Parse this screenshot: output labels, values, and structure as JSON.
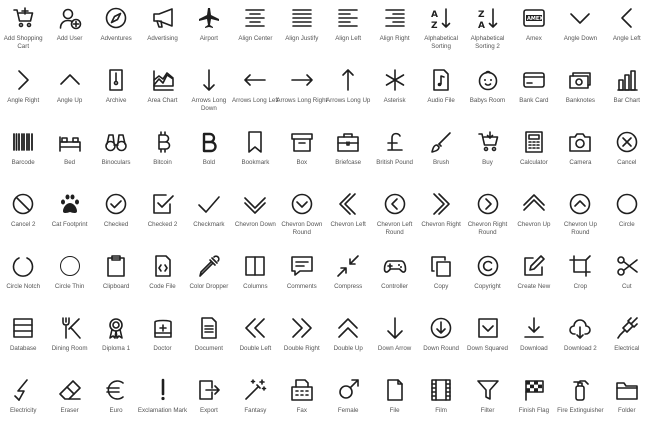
{
  "grid": {
    "columns": 14,
    "rows": 7,
    "items": [
      {
        "label": "Add Shopping Cart",
        "icon": "add-shopping-cart-icon"
      },
      {
        "label": "Add User",
        "icon": "add-user-icon"
      },
      {
        "label": "Adventures",
        "icon": "compass-icon"
      },
      {
        "label": "Advertising",
        "icon": "megaphone-icon"
      },
      {
        "label": "Airport",
        "icon": "airplane-icon"
      },
      {
        "label": "Align Center",
        "icon": "align-center-icon"
      },
      {
        "label": "Align Justify",
        "icon": "align-justify-icon"
      },
      {
        "label": "Align Left",
        "icon": "align-left-icon"
      },
      {
        "label": "Align Right",
        "icon": "align-right-icon"
      },
      {
        "label": "Alphabetical Sorting",
        "icon": "sort-az-icon"
      },
      {
        "label": "Alphabetical Sorting 2",
        "icon": "sort-za-icon"
      },
      {
        "label": "Amex",
        "icon": "amex-icon"
      },
      {
        "label": "Angle Down",
        "icon": "angle-down-icon"
      },
      {
        "label": "Angle Left",
        "icon": "angle-left-icon"
      },
      {
        "label": "Angle Right",
        "icon": "angle-right-icon"
      },
      {
        "label": "Angle Up",
        "icon": "angle-up-icon"
      },
      {
        "label": "Archive",
        "icon": "archive-icon"
      },
      {
        "label": "Area Chart",
        "icon": "area-chart-icon"
      },
      {
        "label": "Arrows Long Down",
        "icon": "arrow-long-down-icon"
      },
      {
        "label": "Arrows Long Left",
        "icon": "arrow-long-left-icon"
      },
      {
        "label": "Arrows Long Right",
        "icon": "arrow-long-right-icon"
      },
      {
        "label": "Arrows Long Up",
        "icon": "arrow-long-up-icon"
      },
      {
        "label": "Asterisk",
        "icon": "asterisk-icon"
      },
      {
        "label": "Audio File",
        "icon": "audio-file-icon"
      },
      {
        "label": "Babys Room",
        "icon": "baby-icon"
      },
      {
        "label": "Bank Card",
        "icon": "bank-card-icon"
      },
      {
        "label": "Banknotes",
        "icon": "banknotes-icon"
      },
      {
        "label": "Bar Chart",
        "icon": "bar-chart-icon"
      },
      {
        "label": "Barcode",
        "icon": "barcode-icon"
      },
      {
        "label": "Bed",
        "icon": "bed-icon"
      },
      {
        "label": "Binoculars",
        "icon": "binoculars-icon"
      },
      {
        "label": "Bitcoin",
        "icon": "bitcoin-icon"
      },
      {
        "label": "Bold",
        "icon": "bold-icon"
      },
      {
        "label": "Bookmark",
        "icon": "bookmark-icon"
      },
      {
        "label": "Box",
        "icon": "box-icon"
      },
      {
        "label": "Briefcase",
        "icon": "briefcase-icon"
      },
      {
        "label": "British Pound",
        "icon": "pound-icon"
      },
      {
        "label": "Brush",
        "icon": "brush-icon"
      },
      {
        "label": "Buy",
        "icon": "buy-cart-icon"
      },
      {
        "label": "Calculator",
        "icon": "calculator-icon"
      },
      {
        "label": "Camera",
        "icon": "camera-icon"
      },
      {
        "label": "Cancel",
        "icon": "cancel-icon"
      },
      {
        "label": "Cancel 2",
        "icon": "cancel-2-icon"
      },
      {
        "label": "Cat Footprint",
        "icon": "cat-footprint-icon"
      },
      {
        "label": "Checked",
        "icon": "checked-icon"
      },
      {
        "label": "Checked 2",
        "icon": "checked-2-icon"
      },
      {
        "label": "Checkmark",
        "icon": "checkmark-icon"
      },
      {
        "label": "Chevron Down",
        "icon": "chevron-down-icon"
      },
      {
        "label": "Chevron Down Round",
        "icon": "chevron-down-round-icon"
      },
      {
        "label": "Chevron Left",
        "icon": "chevron-left-icon"
      },
      {
        "label": "Chevron Left Round",
        "icon": "chevron-left-round-icon"
      },
      {
        "label": "Chevron Right",
        "icon": "chevron-right-icon"
      },
      {
        "label": "Chevron Right Round",
        "icon": "chevron-right-round-icon"
      },
      {
        "label": "Chevron Up",
        "icon": "chevron-up-icon"
      },
      {
        "label": "Chevron Up Round",
        "icon": "chevron-up-round-icon"
      },
      {
        "label": "Circle",
        "icon": "circle-icon"
      },
      {
        "label": "Circle Notch",
        "icon": "circle-notch-icon"
      },
      {
        "label": "Circle Thin",
        "icon": "circle-thin-icon"
      },
      {
        "label": "Clipboard",
        "icon": "clipboard-icon"
      },
      {
        "label": "Code File",
        "icon": "code-file-icon"
      },
      {
        "label": "Color Dropper",
        "icon": "color-dropper-icon"
      },
      {
        "label": "Columns",
        "icon": "columns-icon"
      },
      {
        "label": "Comments",
        "icon": "comments-icon"
      },
      {
        "label": "Compress",
        "icon": "compress-icon"
      },
      {
        "label": "Controller",
        "icon": "controller-icon"
      },
      {
        "label": "Copy",
        "icon": "copy-icon"
      },
      {
        "label": "Copyright",
        "icon": "copyright-icon"
      },
      {
        "label": "Create New",
        "icon": "create-new-icon"
      },
      {
        "label": "Crop",
        "icon": "crop-icon"
      },
      {
        "label": "Cut",
        "icon": "cut-icon"
      },
      {
        "label": "Database",
        "icon": "database-icon"
      },
      {
        "label": "Dining Room",
        "icon": "dining-icon"
      },
      {
        "label": "Diploma 1",
        "icon": "diploma-icon"
      },
      {
        "label": "Doctor",
        "icon": "doctor-icon"
      },
      {
        "label": "Document",
        "icon": "document-icon"
      },
      {
        "label": "Double Left",
        "icon": "double-left-icon"
      },
      {
        "label": "Double Right",
        "icon": "double-right-icon"
      },
      {
        "label": "Double Up",
        "icon": "double-up-icon"
      },
      {
        "label": "Down Arrow",
        "icon": "down-arrow-icon"
      },
      {
        "label": "Down Round",
        "icon": "down-round-icon"
      },
      {
        "label": "Down Squared",
        "icon": "down-squared-icon"
      },
      {
        "label": "Download",
        "icon": "download-icon"
      },
      {
        "label": "Download 2",
        "icon": "cloud-download-icon"
      },
      {
        "label": "Electrical",
        "icon": "electrical-plug-icon"
      },
      {
        "label": "Electricity",
        "icon": "electricity-icon"
      },
      {
        "label": "Eraser",
        "icon": "eraser-icon"
      },
      {
        "label": "Euro",
        "icon": "euro-icon"
      },
      {
        "label": "Exclamation Mark",
        "icon": "exclamation-mark-icon"
      },
      {
        "label": "Export",
        "icon": "export-icon"
      },
      {
        "label": "Fantasy",
        "icon": "magic-wand-icon"
      },
      {
        "label": "Fax",
        "icon": "fax-icon"
      },
      {
        "label": "Female",
        "icon": "female-icon"
      },
      {
        "label": "File",
        "icon": "file-icon"
      },
      {
        "label": "Film",
        "icon": "film-icon"
      },
      {
        "label": "Filter",
        "icon": "filter-icon"
      },
      {
        "label": "Finish Flag",
        "icon": "finish-flag-icon"
      },
      {
        "label": "Fire Extinguisher",
        "icon": "fire-extinguisher-icon"
      },
      {
        "label": "Folder",
        "icon": "folder-icon"
      }
    ]
  }
}
